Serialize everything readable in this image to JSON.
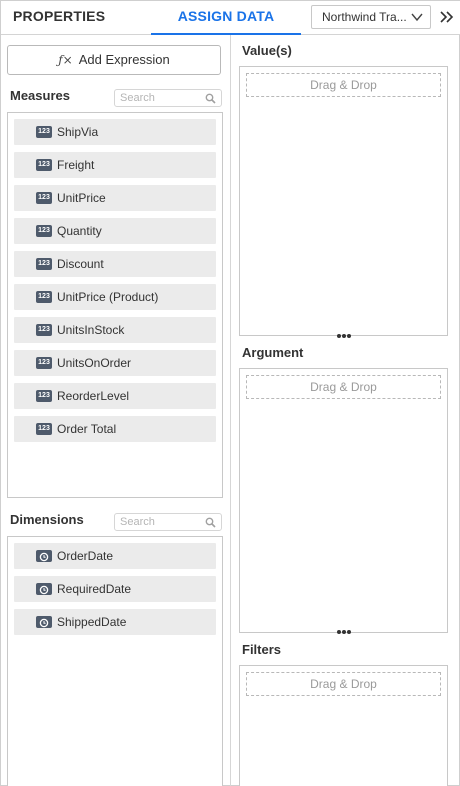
{
  "header": {
    "tabs": [
      {
        "label": "PROPERTIES",
        "active": false
      },
      {
        "label": "ASSIGN DATA",
        "active": true
      }
    ],
    "datasource": {
      "selected": "Northwind Tra..."
    },
    "active_color": "#1a73e8"
  },
  "left_panel": {
    "add_expression_label": "Add Expression",
    "add_expression_icon": "fx-icon",
    "measures": {
      "title": "Measures",
      "search_placeholder": "Search",
      "items": [
        {
          "label": "ShipVia",
          "icon": "numeric-123-icon",
          "badge": "123"
        },
        {
          "label": "Freight",
          "icon": "numeric-123-icon",
          "badge": "123"
        },
        {
          "label": "UnitPrice",
          "icon": "numeric-123-icon",
          "badge": "123"
        },
        {
          "label": "Quantity",
          "icon": "numeric-123-icon",
          "badge": "123"
        },
        {
          "label": "Discount",
          "icon": "numeric-123-icon",
          "badge": "123"
        },
        {
          "label": "UnitPrice (Product)",
          "icon": "numeric-123-icon",
          "badge": "123"
        },
        {
          "label": "UnitsInStock",
          "icon": "numeric-123-icon",
          "badge": "123"
        },
        {
          "label": "UnitsOnOrder",
          "icon": "numeric-123-icon",
          "badge": "123"
        },
        {
          "label": "ReorderLevel",
          "icon": "numeric-123-icon",
          "badge": "123"
        },
        {
          "label": "Order Total",
          "icon": "numeric-123-icon",
          "badge": "123"
        }
      ]
    },
    "dimensions": {
      "title": "Dimensions",
      "search_placeholder": "Search",
      "items": [
        {
          "label": "OrderDate",
          "icon": "clock-icon"
        },
        {
          "label": "RequiredDate",
          "icon": "clock-icon"
        },
        {
          "label": "ShippedDate",
          "icon": "clock-icon"
        }
      ]
    }
  },
  "right_panel": {
    "sections": [
      {
        "title": "Value(s)",
        "placeholder": "Drag & Drop"
      },
      {
        "title": "Argument",
        "placeholder": "Drag & Drop"
      },
      {
        "title": "Filters",
        "placeholder": "Drag & Drop"
      }
    ]
  }
}
